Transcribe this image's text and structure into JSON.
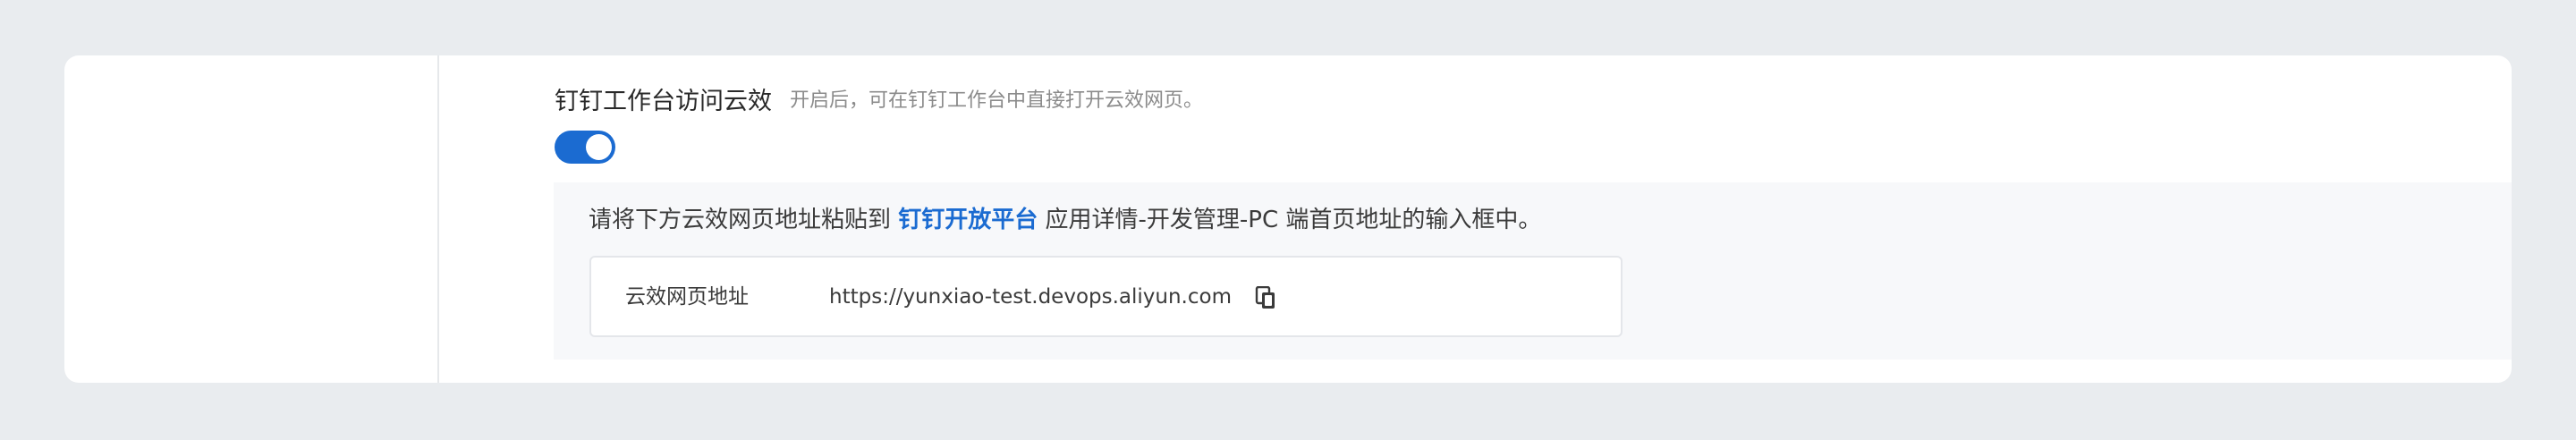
{
  "setting": {
    "title": "钉钉工作台访问云效",
    "description": "开启后，可在钉钉工作台中直接打开云效网页。",
    "toggle_on": true,
    "accent_color": "#1b6bd1"
  },
  "instruction": {
    "prefix": "请将下方云效网页地址粘贴到 ",
    "link_text": "钉钉开放平台",
    "suffix": " 应用详情-开发管理-PC 端首页地址的输入框中。"
  },
  "field": {
    "label": "云效网页地址",
    "value": "https://yunxiao-test.devops.aliyun.com",
    "copy_icon": "copy-icon"
  }
}
